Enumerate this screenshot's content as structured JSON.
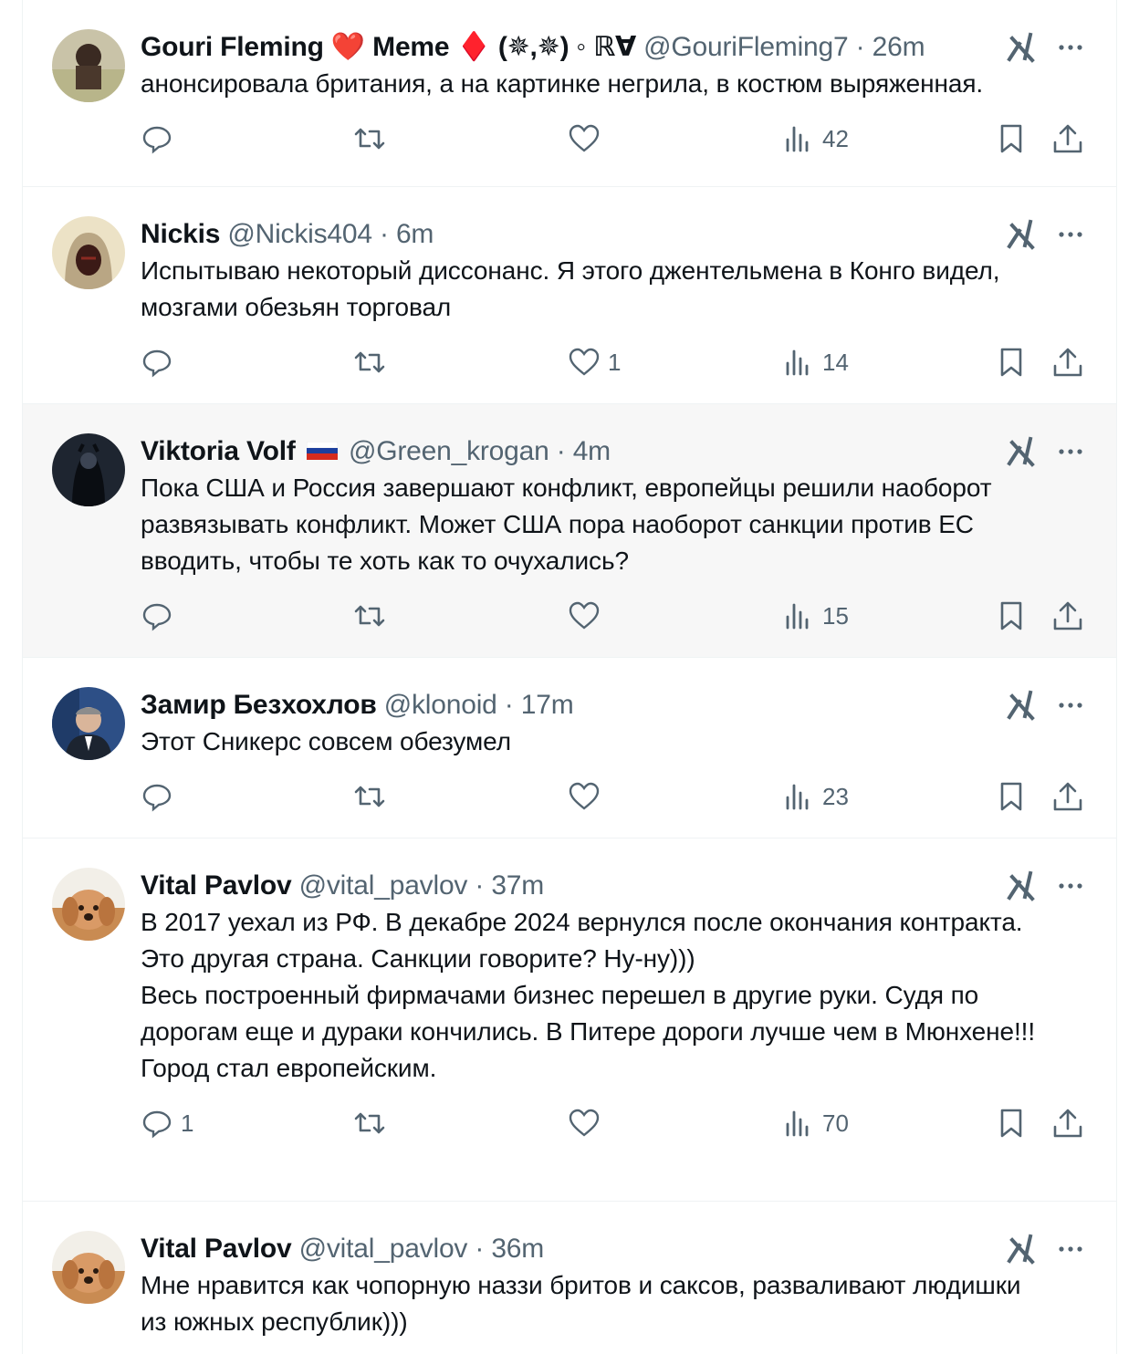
{
  "tweets": [
    {
      "name": "Gouri Fleming ❤️ Meme ♦️ (✵,✵) ◦ ℝ∀",
      "handle": "@GouriFleming7",
      "time": "26m",
      "text": "анонсировала британия, а на картинке негрила, в костюм выряженная.",
      "replies": "",
      "likes": "",
      "views": "42"
    },
    {
      "name": "Nickis",
      "handle": "@Nickis404",
      "time": "6m",
      "text": "Испытываю некоторый диссонанс. Я этого джентельмена в Конго видел, мозгами обезьян торговал",
      "replies": "",
      "likes": "1",
      "views": "14"
    },
    {
      "name": "Viktoria Volf",
      "handle": "@Green_krogan",
      "time": "4m",
      "text": "Пока США и Россия завершают конфликт, европейцы решили наоборот развязывать конфликт. Может США пора наоборот санкции против ЕС вводить, чтобы те хоть как то очухались?",
      "replies": "",
      "likes": "",
      "views": "15"
    },
    {
      "name": "Замир Безхохлов",
      "handle": "@klonoid",
      "time": "17m",
      "text": "Этот Сникерс совсем обезумел",
      "replies": "",
      "likes": "",
      "views": "23"
    },
    {
      "name": "Vital Pavlov",
      "handle": "@vital_pavlov",
      "time": "37m",
      "text": "В 2017 уехал из РФ. В декабре 2024 вернулся после окончания контракта.\nЭто другая страна. Санкции говорите? Ну-ну)))\nВесь построенный фирмачами бизнес перешел в другие руки. Судя по дорогам еще и дураки кончились. В Питере дороги лучше чем в Мюнхене!!! Город стал европейским.",
      "replies": "1",
      "likes": "",
      "views": "70"
    },
    {
      "name": "Vital Pavlov",
      "handle": "@vital_pavlov",
      "time": "36m",
      "text": "Мне нравится как чопорную наззи бритов и саксов, разваливают людишки из южных республик)))",
      "replies": "",
      "likes": "",
      "views": ""
    }
  ],
  "separator": "·",
  "icons": [
    "grok-icon",
    "more-icon",
    "reply-icon",
    "retweet-icon",
    "like-icon",
    "views-icon",
    "bookmark-icon",
    "share-icon"
  ],
  "colors": {
    "text": "#0f1419",
    "muted": "#536471",
    "border": "#eff3f4",
    "highlight": "#f7f7f7",
    "heart": "#e0245e",
    "diamond": "#dd2e44"
  }
}
